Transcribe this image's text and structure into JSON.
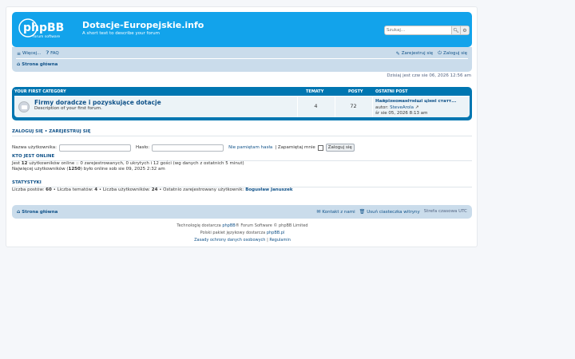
{
  "header": {
    "site_title": "Dotacje-Europejskie.info",
    "site_description": "A short text to describe your forum",
    "logo_text": "phpBB",
    "logo_sub": "forum software",
    "search_placeholder": "Szukaj..."
  },
  "nav": {
    "more": "Więcej...",
    "faq": "FAQ",
    "register": "Zarejestruj się",
    "login": "Zaloguj się",
    "breadcrumb": "Strona główna"
  },
  "datebar": "Dzisiaj jest czw sie 06, 2026 12:56 am",
  "category": {
    "title": "YOUR FIRST CATEGORY",
    "col_topics": "TEMATY",
    "col_posts": "POSTY",
    "col_last": "OSTATNI POST",
    "forum": {
      "title": "Firmy doradcze i pozyskujące dotacje",
      "description": "Description of your first forum.",
      "topics": "4",
      "posts": "72",
      "last_title": "Найрізноманітніші цінні статт...",
      "last_author_prefix": "autor:",
      "last_author": "SteveArola",
      "last_date": "śr sie 05, 2026 8:13 am"
    }
  },
  "login": {
    "heading_login": "ZALOGUJ SIĘ",
    "heading_sep": "•",
    "heading_register": "ZAREJESTRUJ SIĘ",
    "username_label": "Nazwa użytkownika:",
    "password_label": "Hasło:",
    "forgot": "Nie pamiętam hasła",
    "remember": "| Zapamiętaj mnie",
    "button": "Zaloguj się"
  },
  "online": {
    "heading": "KTO JEST ONLINE",
    "line1_pre": "Jest",
    "line1_count": "12",
    "line1_post": "użytkowników online :: 0 zarejestrowanych, 0 ukrytych i 12 gości (wg danych z ostatnich 5 minut)",
    "line2_pre": "Najwięcej użytkowników (",
    "line2_count": "1250",
    "line2_post": ") było online sob sie 09, 2025 2:32 am"
  },
  "stats": {
    "heading": "STATYSTYKI",
    "posts_label": "Liczba postów:",
    "posts": "60",
    "topics_label": "• Liczba tematów:",
    "topics": "4",
    "users_label": "• Liczba użytkowników:",
    "users": "24",
    "newest_label": "• Ostatnio zarejestrowany użytkownik:",
    "newest": "Bogusław Januszek"
  },
  "footer": {
    "breadcrumb": "Strona główna",
    "contact": "Kontakt z nami",
    "cookies": "Usuń ciasteczka witryny",
    "timezone": "Strefa czasowa UTC",
    "line1_pre": "Technologię dostarcza",
    "line1_link": "phpBB",
    "line1_post": "® Forum Software © phpBB Limited",
    "line2_pre": "Polski pakiet językowy dostarcza",
    "line2_link": "phpBB.pl",
    "privacy": "Zasady ochrony danych osobowych",
    "terms_sep": "|",
    "terms": "Regulamin"
  },
  "colors": {
    "header": "#12a3eb",
    "navbar": "#cadceb",
    "category": "#0076b1",
    "link": "#105289"
  }
}
